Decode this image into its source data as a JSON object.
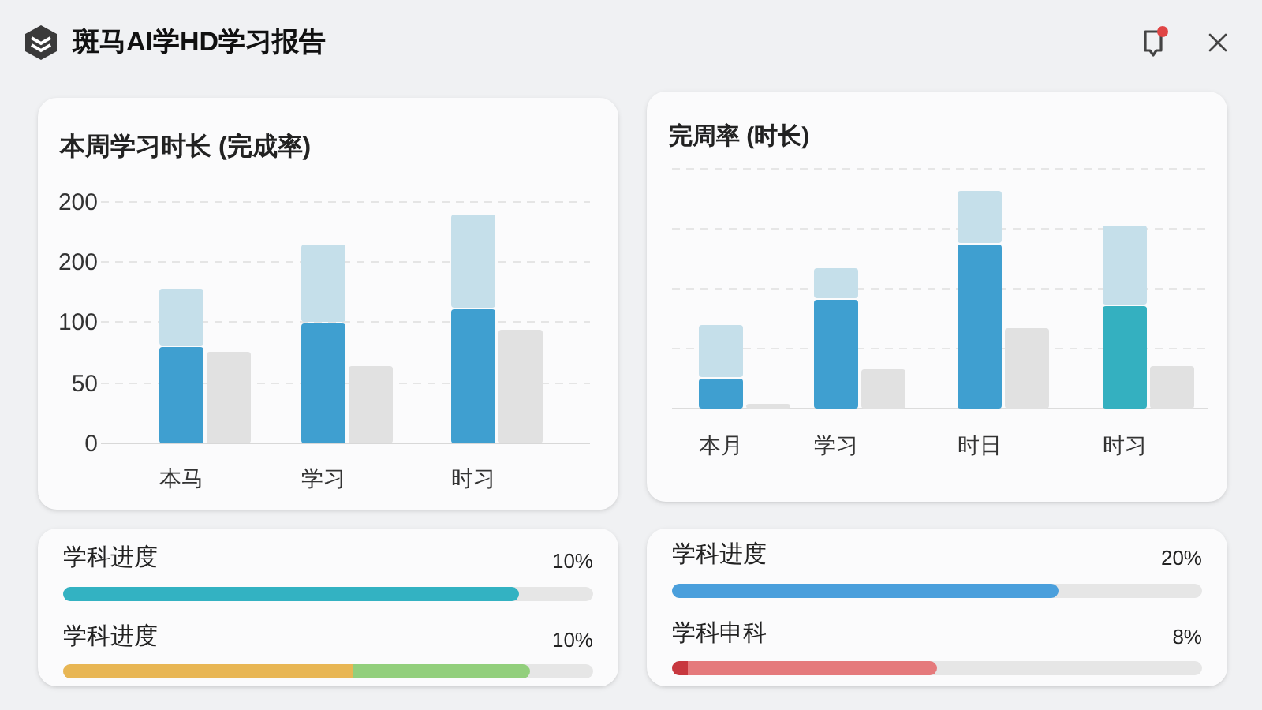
{
  "window": {
    "title": "斑马AI学HD学习报告"
  },
  "left_chart": {
    "title": "本周学习时长 (完成率)",
    "y_labels": [
      "200",
      "200",
      "100",
      "50",
      "0"
    ],
    "categories": [
      "本马",
      "学习",
      "时习"
    ]
  },
  "right_chart": {
    "title": "完周率 (时长)",
    "categories": [
      "本月",
      "学习",
      "时日",
      "时习"
    ]
  },
  "left_progress": [
    {
      "label": "学科进度",
      "value": "10%",
      "kind": "solid",
      "color": "#33b2c2",
      "level": 0.86
    },
    {
      "label": "学科进度",
      "value": "10%",
      "kind": "split",
      "color": "#e8b654",
      "level": 0.88
    }
  ],
  "right_progress": [
    {
      "label": "学科进度",
      "value": "20%",
      "kind": "solid",
      "color": "#4a9fdc",
      "level": 0.73
    },
    {
      "label": "学科申科",
      "value": "8%",
      "kind": "capped",
      "color": "#e57a7c",
      "level": 0.5
    }
  ]
}
